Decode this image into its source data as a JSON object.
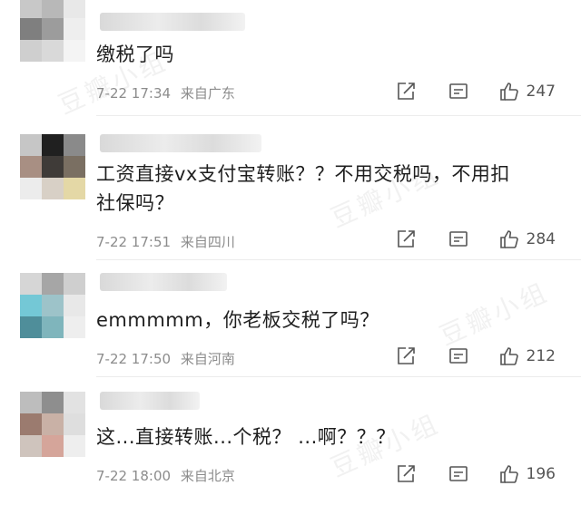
{
  "watermark": "豆瓣小组",
  "comments": [
    {
      "text": "缴税了吗",
      "time": "7-22 17:34",
      "location": "来自广东",
      "likes": "247"
    },
    {
      "text": "工资直接vx支付宝转账？？不用交税吗，不用扣\n社保吗？",
      "time": "7-22 17:51",
      "location": "来自四川",
      "likes": "284"
    },
    {
      "text": "emmmmm，你老板交税了吗？",
      "time": "7-22 17:50",
      "location": "来自河南",
      "likes": "212"
    },
    {
      "text": "这...直接转账...个税？ ...啊？？？",
      "time": "7-22 18:00",
      "location": "来自北京",
      "likes": "196"
    }
  ],
  "icons": {
    "share": "share-icon",
    "reply": "reply-icon",
    "like": "thumbs-up-icon"
  },
  "colors": {
    "text": "#1f1f1f",
    "meta": "#8c8c8c",
    "icon": "#555555"
  }
}
